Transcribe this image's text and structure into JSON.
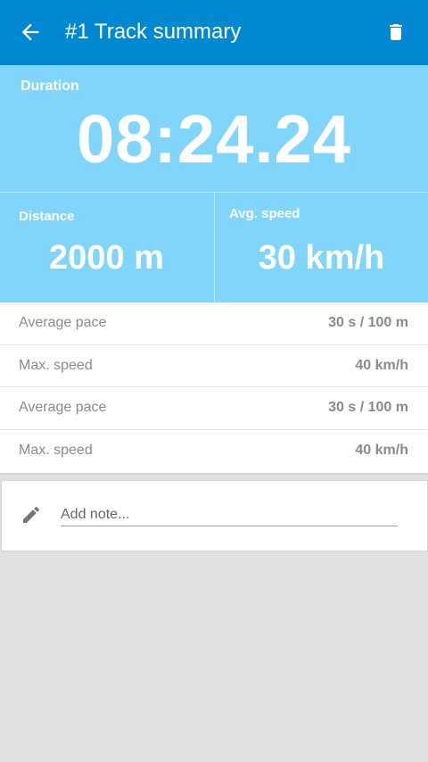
{
  "appbar": {
    "title": "#1 Track summary",
    "back_icon": "arrow-left-icon",
    "delete_icon": "trash-icon",
    "color": "#0288d1"
  },
  "duration": {
    "label": "Duration",
    "value": "08:24.24"
  },
  "stats": {
    "distance_label": "Distance",
    "distance_value": "2000 m",
    "speed_label": "Avg. speed",
    "speed_value": "30 km/h",
    "panel_color": "#81d4fa"
  },
  "details": [
    {
      "label": "Average pace",
      "value": "30 s / 100 m"
    },
    {
      "label": "Max. speed",
      "value": "40 km/h"
    },
    {
      "label": "Average pace",
      "value": "30 s / 100 m"
    },
    {
      "label": "Max. speed",
      "value": "40 km/h"
    }
  ],
  "note": {
    "placeholder": "Add note...",
    "icon": "pencil-icon"
  }
}
